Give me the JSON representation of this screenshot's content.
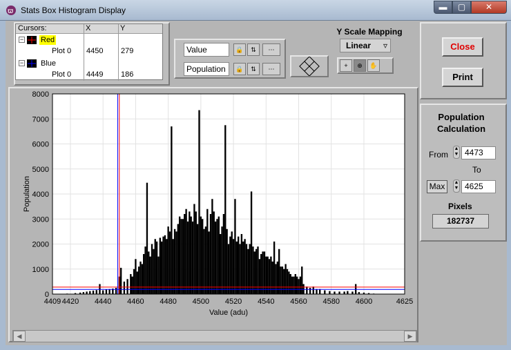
{
  "window": {
    "title": "Stats Box Histogram Display",
    "min_glyph": "▬",
    "max_glyph": "▢",
    "close_glyph": "✕"
  },
  "cursors": {
    "header": {
      "name": "Cursors:",
      "x": "X",
      "y": "Y"
    },
    "items": [
      {
        "label": "Red",
        "plot": "Plot 0",
        "x": "4450",
        "y": "279",
        "color": "#ff0000"
      },
      {
        "label": "Blue",
        "plot": "Plot 0",
        "x": "4449",
        "y": "186",
        "color": "#0000ff"
      }
    ]
  },
  "axes_panel": {
    "x_name": "Value",
    "y_name": "Population"
  },
  "y_scale": {
    "title": "Y Scale Mapping",
    "value": "Linear"
  },
  "buttons": {
    "close": "Close",
    "print": "Print"
  },
  "population": {
    "title_line1": "Population",
    "title_line2": "Calculation",
    "from_label": "From",
    "from_value": "4473",
    "to_label": "To",
    "max_label": "Max",
    "to_value": "4625",
    "pixels_label": "Pixels",
    "pixels_value": "182737"
  },
  "chart_data": {
    "type": "bar",
    "xlabel": "Value (adu)",
    "ylabel": "Population",
    "xlim": [
      4409,
      4625
    ],
    "ylim": [
      0,
      8000
    ],
    "xticks": [
      4409,
      4420,
      4440,
      4460,
      4480,
      4500,
      4520,
      4540,
      4560,
      4580,
      4600,
      4625
    ],
    "yticks": [
      0,
      1000,
      2000,
      3000,
      4000,
      5000,
      6000,
      7000,
      8000
    ],
    "grid": true,
    "bar_color": "#000000",
    "cursors": [
      {
        "name": "Red",
        "x": 4450,
        "y": 279,
        "color": "#ff0000"
      },
      {
        "name": "Blue",
        "x": 4449,
        "y": 186,
        "color": "#0000ff"
      }
    ],
    "bins": [
      [
        4418,
        20
      ],
      [
        4423,
        40
      ],
      [
        4426,
        60
      ],
      [
        4428,
        80
      ],
      [
        4430,
        100
      ],
      [
        4432,
        120
      ],
      [
        4434,
        140
      ],
      [
        4436,
        160
      ],
      [
        4438,
        400
      ],
      [
        4440,
        150
      ],
      [
        4442,
        180
      ],
      [
        4444,
        200
      ],
      [
        4446,
        220
      ],
      [
        4448,
        250
      ],
      [
        4450,
        700
      ],
      [
        4451,
        1050
      ],
      [
        4453,
        500
      ],
      [
        4455,
        600
      ],
      [
        4457,
        800
      ],
      [
        4458,
        700
      ],
      [
        4459,
        1000
      ],
      [
        4460,
        1400
      ],
      [
        4461,
        900
      ],
      [
        4462,
        1100
      ],
      [
        4463,
        1300
      ],
      [
        4464,
        1200
      ],
      [
        4465,
        1600
      ],
      [
        4466,
        1900
      ],
      [
        4467,
        4450
      ],
      [
        4468,
        1700
      ],
      [
        4469,
        1500
      ],
      [
        4470,
        2000
      ],
      [
        4471,
        1800
      ],
      [
        4472,
        2200
      ],
      [
        4473,
        2100
      ],
      [
        4474,
        1500
      ],
      [
        4475,
        2250
      ],
      [
        4476,
        2100
      ],
      [
        4477,
        2300
      ],
      [
        4478,
        2350
      ],
      [
        4479,
        2200
      ],
      [
        4480,
        2700
      ],
      [
        4481,
        2500
      ],
      [
        4482,
        6700
      ],
      [
        4483,
        2200
      ],
      [
        4484,
        2600
      ],
      [
        4485,
        2500
      ],
      [
        4486,
        2800
      ],
      [
        4487,
        3100
      ],
      [
        4488,
        3000
      ],
      [
        4489,
        3000
      ],
      [
        4490,
        3200
      ],
      [
        4491,
        3400
      ],
      [
        4492,
        2900
      ],
      [
        4493,
        3300
      ],
      [
        4494,
        3100
      ],
      [
        4495,
        2900
      ],
      [
        4496,
        3600
      ],
      [
        4497,
        3300
      ],
      [
        4498,
        2800
      ],
      [
        4499,
        7350
      ],
      [
        4500,
        3100
      ],
      [
        4501,
        3000
      ],
      [
        4502,
        2600
      ],
      [
        4503,
        2700
      ],
      [
        4504,
        3400
      ],
      [
        4505,
        2500
      ],
      [
        4506,
        3200
      ],
      [
        4507,
        3800
      ],
      [
        4508,
        3300
      ],
      [
        4509,
        2900
      ],
      [
        4510,
        3000
      ],
      [
        4511,
        3100
      ],
      [
        4512,
        2400
      ],
      [
        4513,
        2700
      ],
      [
        4514,
        3200
      ],
      [
        4515,
        6750
      ],
      [
        4516,
        2600
      ],
      [
        4517,
        2000
      ],
      [
        4518,
        2300
      ],
      [
        4519,
        2500
      ],
      [
        4520,
        2200
      ],
      [
        4521,
        3800
      ],
      [
        4522,
        2100
      ],
      [
        4523,
        2300
      ],
      [
        4524,
        2000
      ],
      [
        4525,
        2400
      ],
      [
        4526,
        2100
      ],
      [
        4527,
        2200
      ],
      [
        4528,
        2000
      ],
      [
        4529,
        1800
      ],
      [
        4530,
        2000
      ],
      [
        4531,
        4100
      ],
      [
        4532,
        1900
      ],
      [
        4533,
        1700
      ],
      [
        4534,
        1800
      ],
      [
        4535,
        1900
      ],
      [
        4536,
        1400
      ],
      [
        4537,
        1600
      ],
      [
        4538,
        1700
      ],
      [
        4539,
        1700
      ],
      [
        4540,
        1500
      ],
      [
        4541,
        1500
      ],
      [
        4542,
        1400
      ],
      [
        4543,
        1500
      ],
      [
        4544,
        1300
      ],
      [
        4545,
        2100
      ],
      [
        4546,
        1200
      ],
      [
        4547,
        1300
      ],
      [
        4548,
        1800
      ],
      [
        4549,
        1100
      ],
      [
        4550,
        1100
      ],
      [
        4551,
        1000
      ],
      [
        4552,
        1200
      ],
      [
        4553,
        1000
      ],
      [
        4554,
        900
      ],
      [
        4555,
        800
      ],
      [
        4556,
        700
      ],
      [
        4557,
        700
      ],
      [
        4558,
        800
      ],
      [
        4559,
        700
      ],
      [
        4560,
        600
      ],
      [
        4561,
        700
      ],
      [
        4562,
        1100
      ],
      [
        4563,
        400
      ],
      [
        4565,
        300
      ],
      [
        4567,
        250
      ],
      [
        4569,
        300
      ],
      [
        4571,
        200
      ],
      [
        4573,
        200
      ],
      [
        4576,
        150
      ],
      [
        4579,
        120
      ],
      [
        4582,
        100
      ],
      [
        4585,
        100
      ],
      [
        4588,
        100
      ],
      [
        4590,
        120
      ],
      [
        4593,
        100
      ],
      [
        4595,
        400
      ],
      [
        4597,
        80
      ],
      [
        4600,
        60
      ],
      [
        4603,
        40
      ],
      [
        4606,
        20
      ]
    ]
  }
}
